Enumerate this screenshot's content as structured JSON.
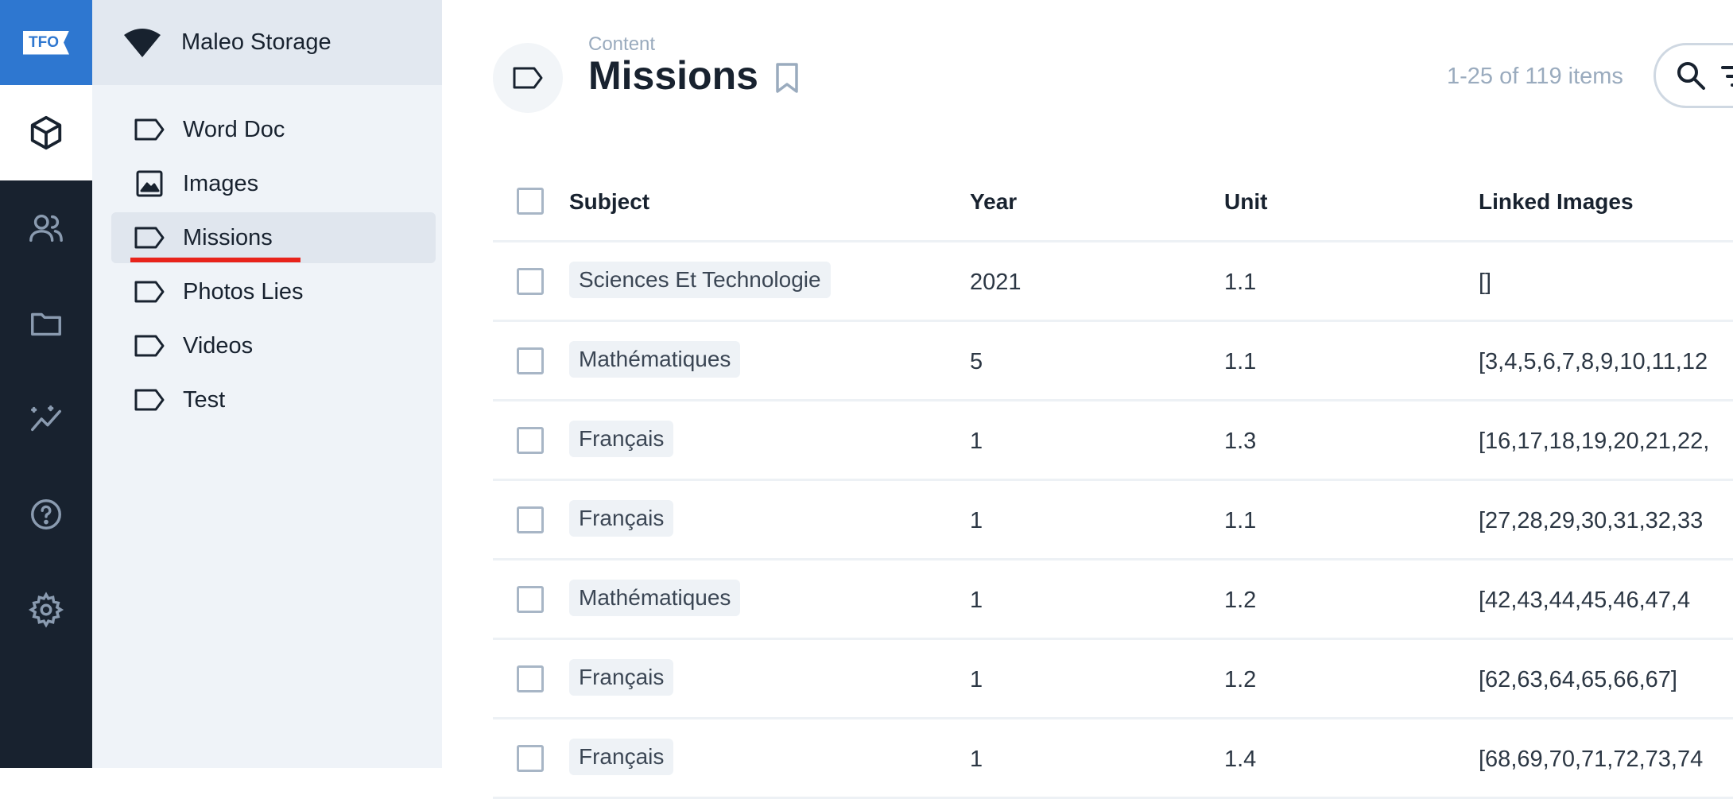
{
  "app": {
    "logo_text": "TFO",
    "storage_name": "Maleo Storage"
  },
  "rail": {
    "items": [
      {
        "icon": "cube-icon",
        "active": true
      },
      {
        "icon": "users-icon",
        "active": false
      },
      {
        "icon": "folder-icon",
        "active": false
      },
      {
        "icon": "analytics-icon",
        "active": false
      },
      {
        "icon": "help-icon",
        "active": false
      },
      {
        "icon": "gear-icon",
        "active": false
      }
    ]
  },
  "sidebar": {
    "items": [
      {
        "label": "Word Doc",
        "icon": "tag-icon"
      },
      {
        "label": "Images",
        "icon": "image-icon"
      },
      {
        "label": "Missions",
        "icon": "tag-icon",
        "active": true
      },
      {
        "label": "Photos Lies",
        "icon": "tag-icon"
      },
      {
        "label": "Videos",
        "icon": "tag-icon"
      },
      {
        "label": "Test",
        "icon": "tag-icon"
      }
    ]
  },
  "header": {
    "breadcrumb": "Content",
    "title": "Missions",
    "count": "1-25 of 119 items"
  },
  "table": {
    "columns": [
      "Subject",
      "Year",
      "Unit",
      "Linked Images"
    ],
    "rows": [
      {
        "subject": "Sciences Et Technologie",
        "year": "2021",
        "unit": "1.1",
        "linked": "[]"
      },
      {
        "subject": "Mathématiques",
        "year": "5",
        "unit": "1.1",
        "linked": "[3,4,5,6,7,8,9,10,11,12"
      },
      {
        "subject": "Français",
        "year": "1",
        "unit": "1.3",
        "linked": "[16,17,18,19,20,21,22,"
      },
      {
        "subject": "Français",
        "year": "1",
        "unit": "1.1",
        "linked": "[27,28,29,30,31,32,33"
      },
      {
        "subject": "Mathématiques",
        "year": "1",
        "unit": "1.2",
        "linked": "[42,43,44,45,46,47,4"
      },
      {
        "subject": "Français",
        "year": "1",
        "unit": "1.2",
        "linked": "[62,63,64,65,66,67]"
      },
      {
        "subject": "Français",
        "year": "1",
        "unit": "1.4",
        "linked": "[68,69,70,71,72,73,74"
      }
    ]
  },
  "colors": {
    "rail_bg": "#18222f",
    "brand_blue": "#2e77d0",
    "sidebar_bg": "#eff3f8",
    "active_underline": "#e8231b"
  }
}
